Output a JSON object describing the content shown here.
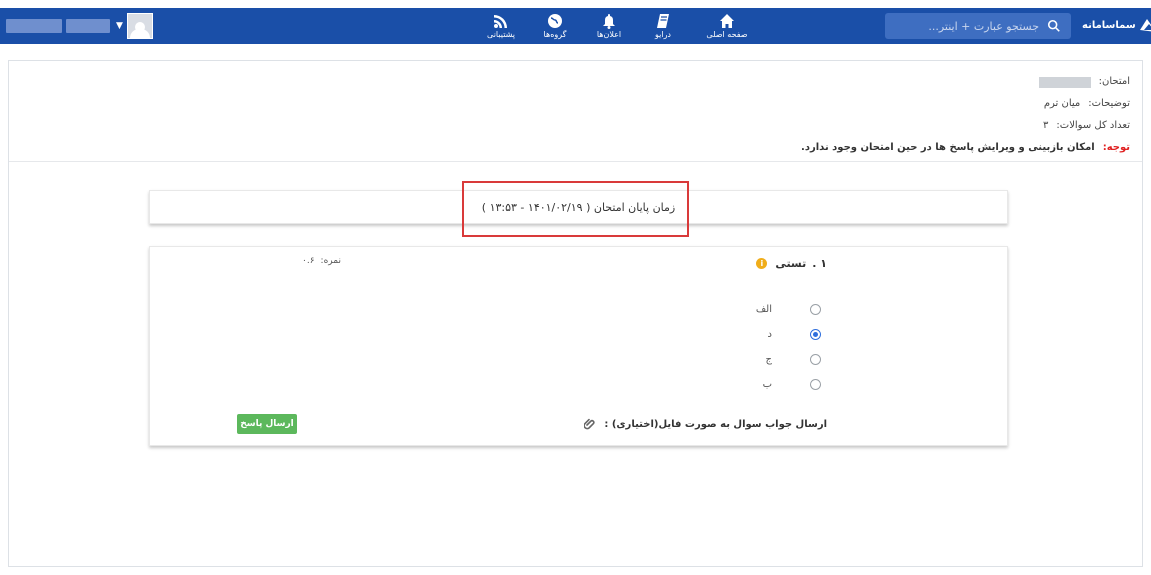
{
  "topbar": {
    "brand": "سماسامانه",
    "search_placeholder": "جستجو عبارت + اینتر...",
    "nav": [
      {
        "label": "صفحه اصلی",
        "icon": "home-icon"
      },
      {
        "label": "درایو",
        "icon": "drive-icon"
      },
      {
        "label": "اعلان‌ها",
        "icon": "bell-icon"
      },
      {
        "label": "گروه‌ها",
        "icon": "globe-icon"
      },
      {
        "label": "پشتیبانی",
        "icon": "rss-icon"
      }
    ],
    "user_icon": "user-avatar-icon"
  },
  "exam": {
    "name_label": "امتحان:",
    "desc_label": "توضیحات:",
    "desc_value": "میان ترم",
    "count_label": "تعداد کل سوالات:",
    "count_value": "۳",
    "warning_label": "توجه:",
    "warning_text": "امکان بازبینی و ویرایش پاسخ ها در حین امتحان وجود ندارد."
  },
  "timer": {
    "text": "زمان پایان امتحان ( ۱۴۰۱/۰۲/۱۹ - ۱۳:۵۳ )"
  },
  "question": {
    "number": "۱ .",
    "title": "تستی",
    "score_label": "نمره:",
    "score_value": "۰.۶",
    "options": [
      {
        "label": "الف",
        "checked": false
      },
      {
        "label": "د",
        "checked": true
      },
      {
        "label": "ج",
        "checked": false
      },
      {
        "label": "ب",
        "checked": false
      }
    ],
    "file_label": "ارسال جواب سوال به صورت فایل(اختیاری) :",
    "submit_label": "ارسال پاسخ"
  },
  "colors": {
    "topbar": "#1a4fa8",
    "warning": "#e02020",
    "submit": "#5cb85c",
    "highlight": "#d93a3a"
  }
}
